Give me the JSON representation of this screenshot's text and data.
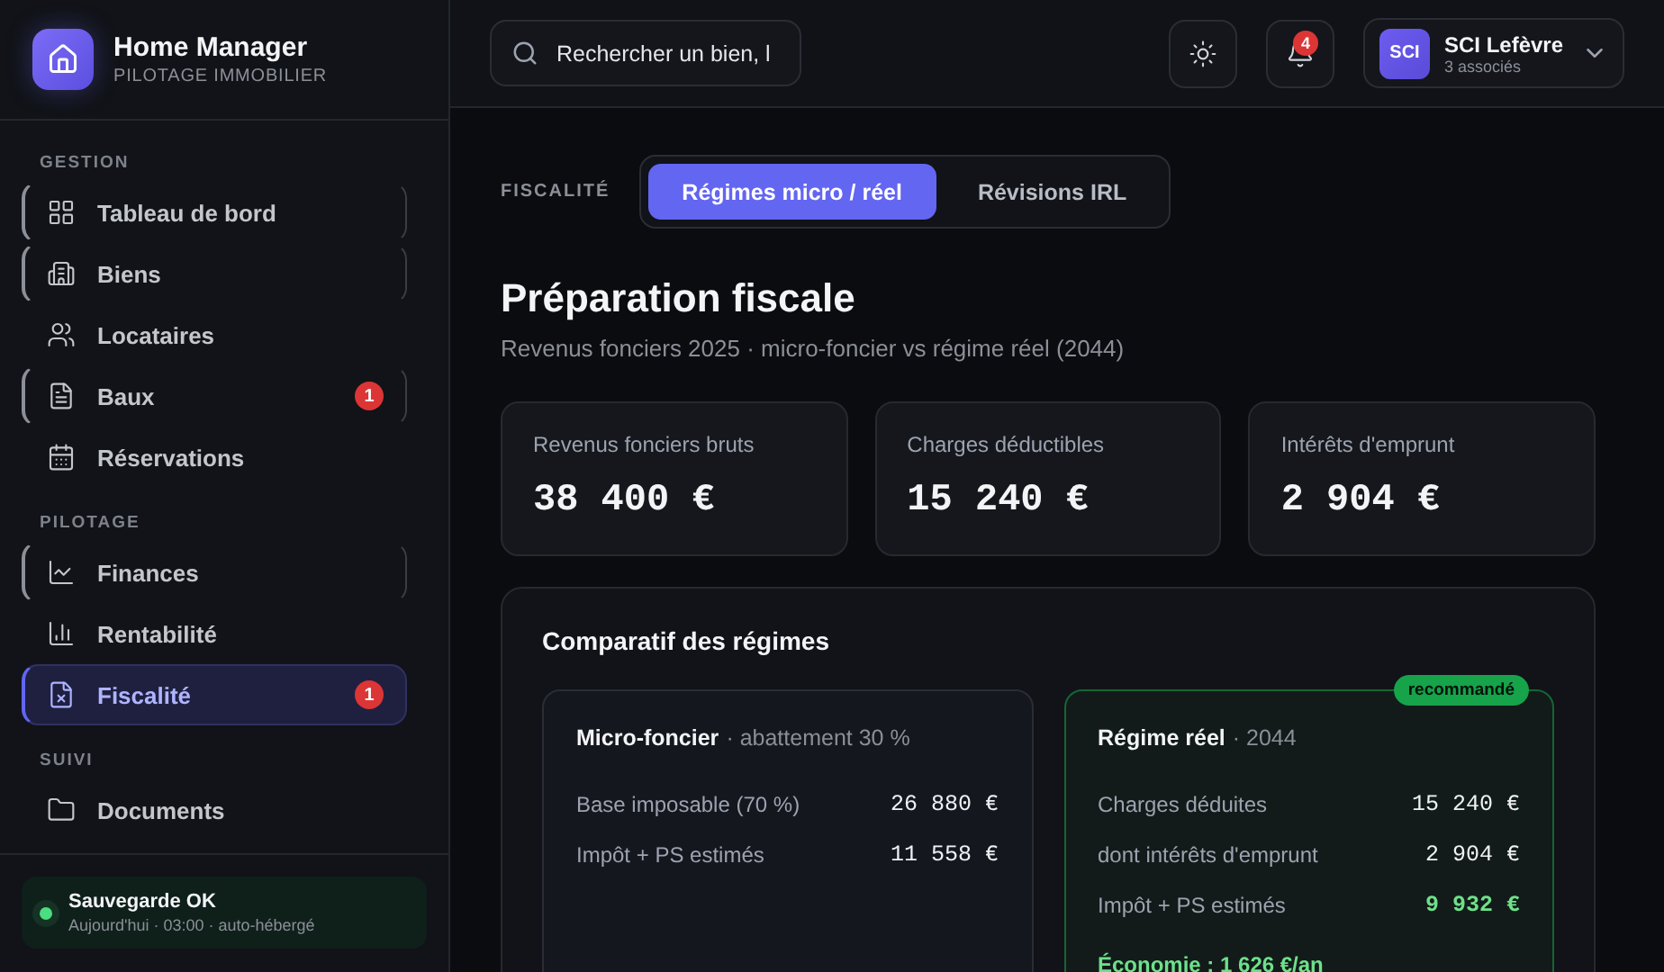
{
  "brand": {
    "name": "Home Manager",
    "tagline": "PILOTAGE IMMOBILIER"
  },
  "sidebar": {
    "sections": [
      {
        "label": "GESTION",
        "items": [
          {
            "label": "Tableau de bord",
            "selected": false,
            "outlined": true
          },
          {
            "label": "Biens",
            "selected": false,
            "outlined": true
          },
          {
            "label": "Locataires",
            "selected": false,
            "outlined": false
          },
          {
            "label": "Baux",
            "selected": false,
            "outlined": true,
            "badge": "1"
          },
          {
            "label": "Réservations",
            "selected": false,
            "outlined": false
          }
        ]
      },
      {
        "label": "PILOTAGE",
        "items": [
          {
            "label": "Finances",
            "selected": false,
            "outlined": true
          },
          {
            "label": "Rentabilité",
            "selected": false,
            "outlined": false
          },
          {
            "label": "Fiscalité",
            "selected": true,
            "outlined": false,
            "badge": "1"
          }
        ]
      },
      {
        "label": "SUIVI",
        "items": [
          {
            "label": "Documents",
            "selected": false,
            "outlined": false
          }
        ]
      }
    ]
  },
  "backup": {
    "title": "Sauvegarde OK",
    "detail": "Aujourd'hui · 03:00 · auto-hébergé",
    "color": "#4ade80"
  },
  "header": {
    "search": {
      "value": "Rechercher un bien, l"
    },
    "notifications": "4",
    "account": {
      "avatar": "SCI",
      "name": "SCI Lefèvre",
      "detail": "3 associés"
    }
  },
  "section_label": "FISCALITÉ",
  "tabs": [
    {
      "label": "Régimes micro / réel",
      "selected": true
    },
    {
      "label": "Révisions IRL",
      "selected": false
    }
  ],
  "title": "Préparation fiscale",
  "subtitle": "Revenus fonciers 2025 · micro-foncier vs régime réel (2044)",
  "stats": [
    {
      "label": "Revenus fonciers bruts",
      "value": "38 400 €"
    },
    {
      "label": "Charges déductibles",
      "value": "15 240 €"
    },
    {
      "label": "Intérêts d'emprunt",
      "value": "2 904 €"
    }
  ],
  "comparison": {
    "title": "Comparatif des régimes",
    "regimes": [
      {
        "name": "Micro-foncier",
        "note": "· abattement 30 %",
        "recommended": false,
        "rows": [
          {
            "label": "Base imposable (70 %)",
            "value": "26 880 €",
            "highlight": false
          },
          {
            "label": "Impôt + PS estimés",
            "value": "11 558 €",
            "highlight": false
          }
        ]
      },
      {
        "name": "Régime réel",
        "note": "· 2044",
        "recommended": true,
        "badge": "recommandé",
        "rows": [
          {
            "label": "Charges déduites",
            "value": "15 240 €",
            "highlight": false
          },
          {
            "label": "dont intérêts d'emprunt",
            "value": "2 904 €",
            "highlight": false
          },
          {
            "label": "Impôt + PS estimés",
            "value": "9 932 €",
            "highlight": true
          }
        ],
        "saving": "Économie : 1 626 €/an"
      }
    ]
  }
}
